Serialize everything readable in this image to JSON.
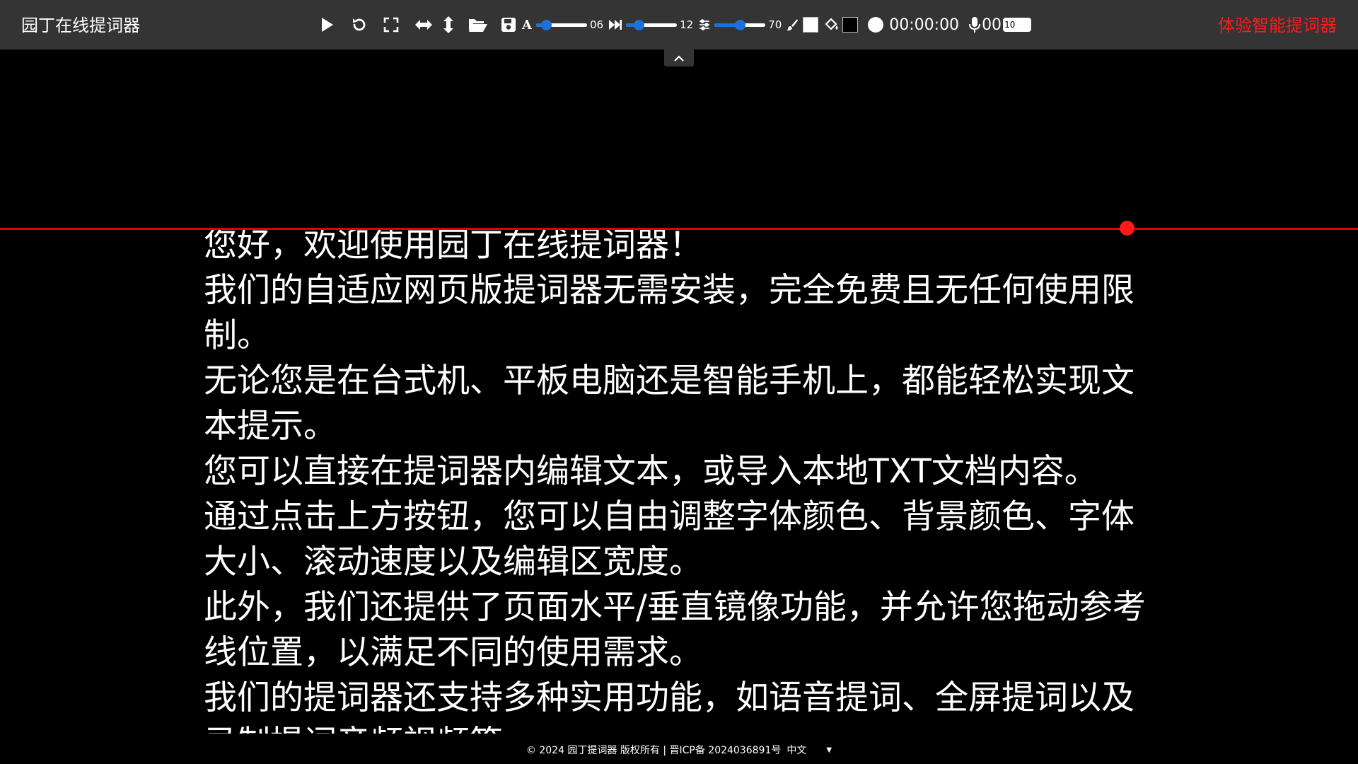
{
  "app_title": "园丁在线提词器",
  "cta_label": "体验智能提词器",
  "toolbar": {
    "icons": [
      "play-icon",
      "reset-icon",
      "fullscreen-icon",
      "mirror-horizontal-icon",
      "mirror-vertical-icon",
      "open-file-icon",
      "save-icon"
    ],
    "font_size": {
      "icon": "font-size-icon",
      "value_label": "06",
      "fraction": 0.2
    },
    "scroll_speed": {
      "icon": "fast-forward-icon",
      "value_label": "12",
      "fraction": 0.25
    },
    "width": {
      "icon": "sliders-icon",
      "value_label": "70",
      "fraction": 0.5
    },
    "font_color": {
      "icon": "brush-icon",
      "color": "#ffffff"
    },
    "bg_color": {
      "icon": "paint-bucket-icon",
      "color": "#000000"
    },
    "timer": "00:00:00",
    "mic_count": "00",
    "mic_input_value": "10"
  },
  "colors": {
    "toolbar_bg": "#343434",
    "accent": "#1e6fd9",
    "reference_line": "#e00000",
    "cta": "#ff1a1a"
  },
  "script_lines": [
    "您好，欢迎使用园丁在线提词器！",
    "我们的自适应网页版提词器无需安装，完全免费且无任何使用限制。",
    "无论您是在台式机、平板电脑还是智能手机上，都能轻松实现文本提示。",
    "您可以直接在提词器内编辑文本，或导入本地TXT文档内容。",
    "通过点击上方按钮，您可以自由调整字体颜色、背景颜色、字体大小、滚动速度以及编辑区宽度。",
    "此外，我们还提供了页面水平/垂直镜像功能，并允许您拖动参考线位置，以满足不同的使用需求。",
    "我们的提词器还支持多种实用功能，如语音提词、全屏提词以及录制提词音频视频等。"
  ],
  "footer": {
    "copyright": "© 2024 园丁提词器 版权所有 | 晋ICP备 2024036891号",
    "language": "中文",
    "caret": "▼"
  }
}
